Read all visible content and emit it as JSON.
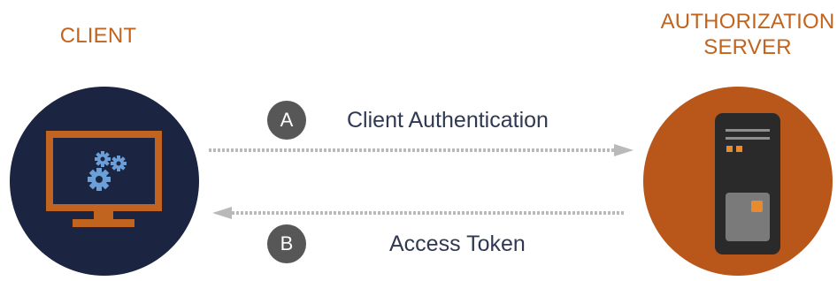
{
  "client": {
    "title": "CLIENT"
  },
  "server": {
    "title_line1": "AUTHORIZATION",
    "title_line2": "SERVER"
  },
  "steps": [
    {
      "badge": "A",
      "label": "Client Authentication",
      "direction": "client-to-server"
    },
    {
      "badge": "B",
      "label": "Access Token",
      "direction": "server-to-client"
    }
  ],
  "colors": {
    "accent": "#c0641f",
    "client_circle": "#1b2440",
    "server_circle": "#b9561a",
    "badge": "#575757",
    "arrow": "#b9b9b9",
    "text": "#2f3a52"
  },
  "icons": {
    "client": "monitor-with-gears-icon",
    "server": "server-tower-icon"
  }
}
